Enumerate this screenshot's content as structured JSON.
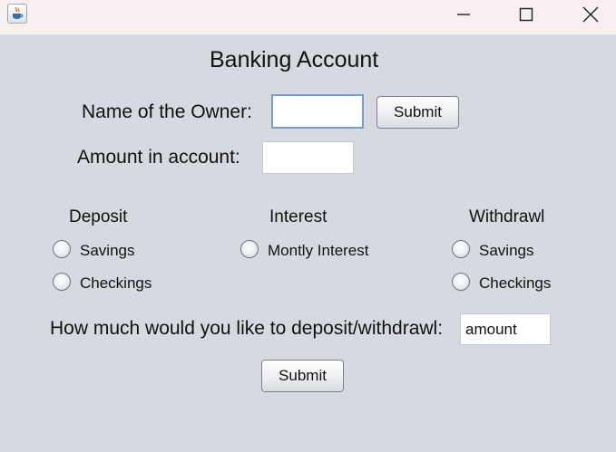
{
  "titlebar": {
    "app_icon": "java-cup-icon",
    "minimize_icon": "minimize-icon",
    "maximize_icon": "maximize-icon",
    "close_icon": "close-icon"
  },
  "form": {
    "title": "Banking Account",
    "owner_label": "Name of the Owner:",
    "owner_value": "",
    "owner_submit": "Submit",
    "amount_label": "Amount in account:",
    "amount_value": "",
    "deposit": {
      "heading": "Deposit",
      "options": [
        "Savings",
        "Checkings"
      ]
    },
    "interest": {
      "heading": "Interest",
      "options": [
        "Montly Interest"
      ]
    },
    "withdrawl": {
      "heading": "Withdrawl",
      "options": [
        "Savings",
        "Checkings"
      ]
    },
    "transaction_label": "How much would you like to deposit/withdrawl:",
    "transaction_value": "amount",
    "submit_label": "Submit"
  },
  "colors": {
    "window_bg": "#d6d9e0",
    "titlebar_bg": "#f7eff0",
    "focus_border": "#7b9bc9"
  }
}
